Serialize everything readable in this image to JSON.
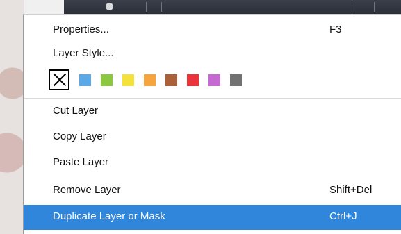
{
  "menu": {
    "properties": {
      "label": "Properties...",
      "shortcut": "F3"
    },
    "layer_style": {
      "label": "Layer Style..."
    },
    "colors": [
      {
        "name": "none",
        "color": "#ffffff"
      },
      {
        "name": "blue",
        "color": "#5aa9e6"
      },
      {
        "name": "green",
        "color": "#8bc83f"
      },
      {
        "name": "yellow",
        "color": "#f5e13b"
      },
      {
        "name": "orange",
        "color": "#f6a43d"
      },
      {
        "name": "brown",
        "color": "#ab6039"
      },
      {
        "name": "red",
        "color": "#eb3439"
      },
      {
        "name": "purple",
        "color": "#c56ad1"
      },
      {
        "name": "gray",
        "color": "#727272"
      }
    ],
    "cut_layer": {
      "label": "Cut Layer"
    },
    "copy_layer": {
      "label": "Copy Layer"
    },
    "paste_layer": {
      "label": "Paste Layer"
    },
    "remove_layer": {
      "label": "Remove Layer",
      "shortcut": "Shift+Del"
    },
    "duplicate_layer": {
      "label": "Duplicate Layer or Mask",
      "shortcut": "Ctrl+J"
    }
  }
}
